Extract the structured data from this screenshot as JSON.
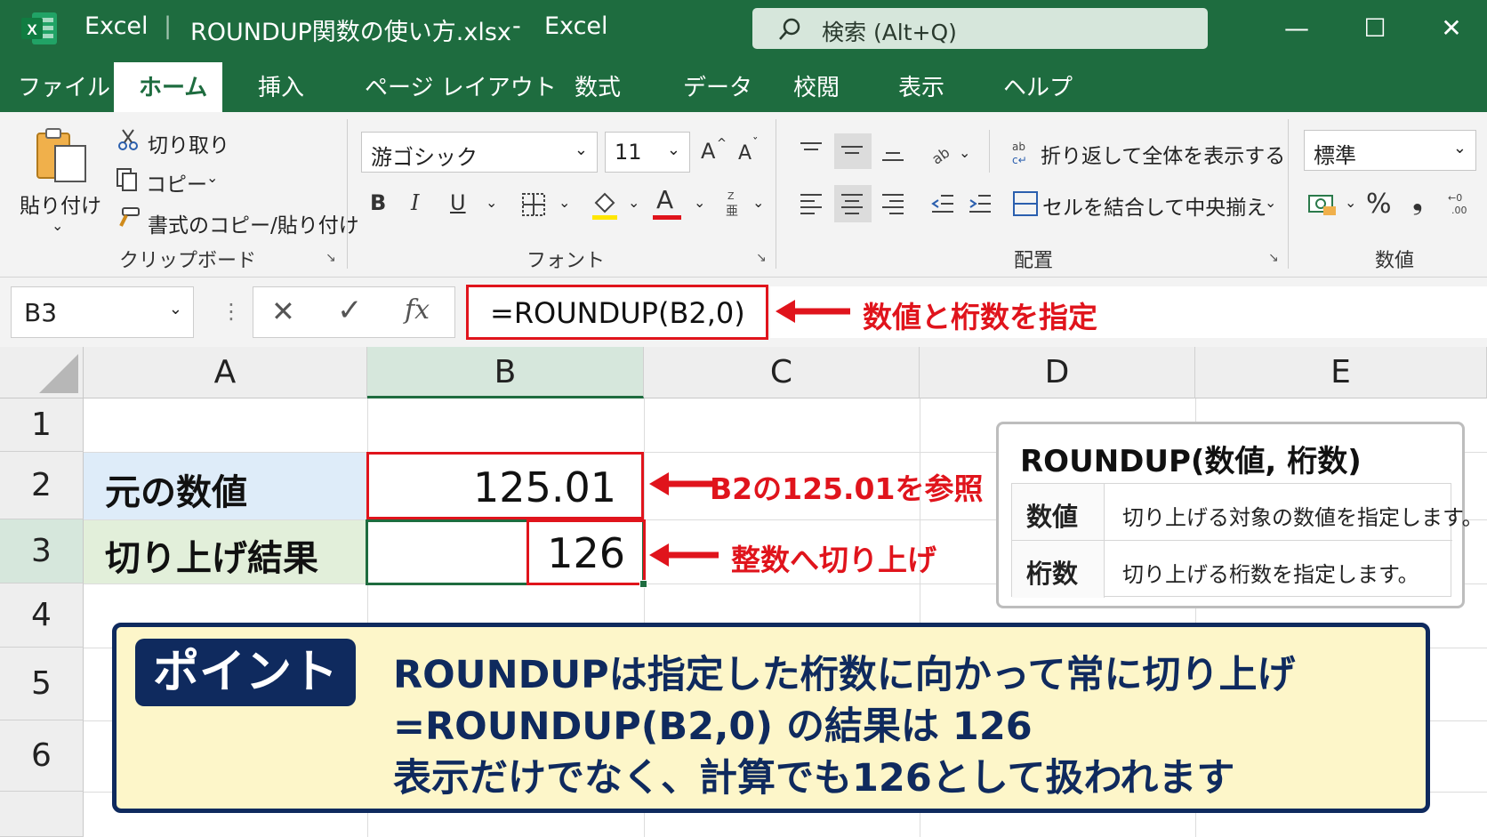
{
  "window": {
    "app_name": "Excel",
    "title_separator": "|",
    "file_name": "ROUNDUP関数の使い方.xlsx",
    "dash": "-",
    "app_name_2": "Excel",
    "search_placeholder": "検索 (Alt+Q)",
    "controls": {
      "minimize": "—",
      "maximize": "☐",
      "close": "✕"
    }
  },
  "menu": {
    "tabs": [
      "ファイル",
      "ホーム",
      "挿入",
      "ページ レイアウト",
      "数式",
      "データ",
      "校閲",
      "表示",
      "ヘルプ"
    ],
    "active": "ホーム"
  },
  "ribbon": {
    "clipboard": {
      "paste": "貼り付け",
      "cut": "切り取り",
      "copy": "コピー",
      "format_painter": "書式のコピー/貼り付け",
      "group": "クリップボード"
    },
    "font": {
      "font_name": "游ゴシック",
      "font_size": "11",
      "grow": "A",
      "shrink": "A",
      "bold": "B",
      "italic": "I",
      "underline": "U",
      "font_color_letter": "A",
      "group": "フォント"
    },
    "alignment": {
      "wrap_text": "折り返して全体を表示する",
      "merge_center": "セルを結合して中央揃え",
      "group": "配置"
    },
    "number": {
      "format": "標準",
      "percent": "%",
      "comma": "❟",
      "group": "数値"
    }
  },
  "formula_bar": {
    "name_box": "B3",
    "cancel": "✕",
    "enter": "✓",
    "fx": "fx",
    "formula": "=ROUNDUP(B2,0)",
    "annotation": "数値と桁数を指定"
  },
  "sheet": {
    "columns": [
      "A",
      "B",
      "C",
      "D",
      "E"
    ],
    "rows": [
      "1",
      "2",
      "3",
      "4",
      "5",
      "6"
    ],
    "a2": "元の数値",
    "b2": "125.01",
    "a3": "切り上げ結果",
    "b3": "126",
    "annot_b2": "B2の125.01を参照",
    "annot_b3": "整数へ切り上げ"
  },
  "info_box": {
    "signature": "ROUNDUP(数値, 桁数)",
    "rows": [
      {
        "arg": "数値",
        "desc": "切り上げる対象の数値を指定します。"
      },
      {
        "arg": "桁数",
        "desc": "切り上げる桁数を指定します。"
      }
    ]
  },
  "point_box": {
    "badge": "ポイント",
    "lines": [
      "ROUNDUPは指定した桁数に向かって常に切り上げ",
      "=ROUNDUP(B2,0) の結果は 126",
      "表示だけでなく、計算でも126として扱われます"
    ]
  },
  "colors": {
    "excel_green": "#1e6c3f",
    "annotation_red": "#e0141c",
    "point_navy": "#0f2a5e",
    "point_bg": "#fdf6c9",
    "a2_fill": "#deecf9",
    "a3_fill": "#e2efda"
  }
}
